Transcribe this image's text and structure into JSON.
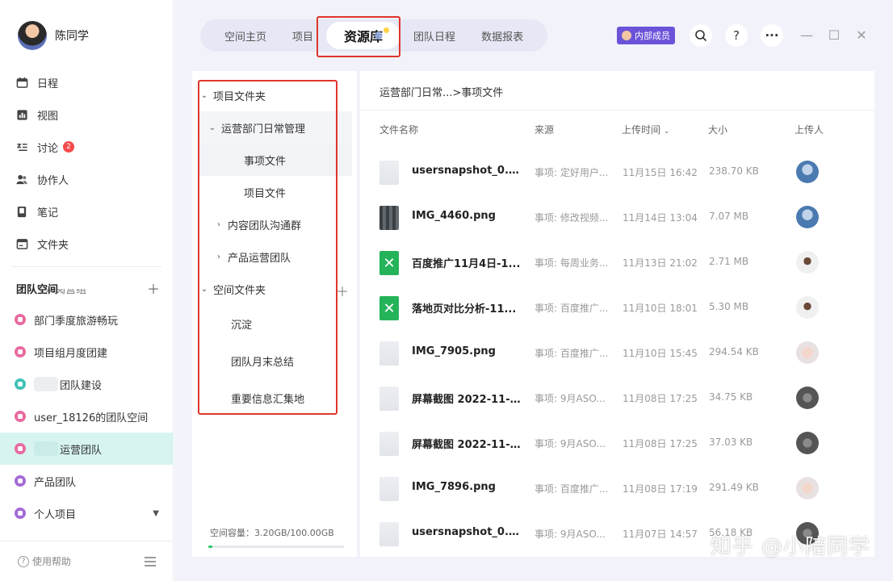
{
  "user": {
    "name": "陈同学"
  },
  "nav": [
    {
      "label": "日程",
      "icon": "calendar-icon"
    },
    {
      "label": "视图",
      "icon": "chart-icon"
    },
    {
      "label": "讨论",
      "icon": "discussion-icon",
      "badge": "2"
    },
    {
      "label": "协作人",
      "icon": "people-icon"
    },
    {
      "label": "笔记",
      "icon": "note-icon"
    },
    {
      "label": "文件夹",
      "icon": "folder-icon"
    }
  ],
  "team_space": {
    "title": "团队空间",
    "cut_label": "飞浆阅营组",
    "items": [
      {
        "label": "部门季度旅游畅玩",
        "color": "#e86aa0"
      },
      {
        "label": "项目组月度团建",
        "color": "#e86aa0"
      },
      {
        "label": "团队建设",
        "color": "#3ec2b5",
        "blurred": true
      },
      {
        "label": "user_18126的团队空间",
        "color": "#e86aa0"
      },
      {
        "label": "运营团队",
        "color": "#e86aa0",
        "blurred": true,
        "active": true
      },
      {
        "label": "产品团队",
        "color": "#a36ad6"
      },
      {
        "label": "个人项目",
        "color": "#a36ad6",
        "caret": "▼"
      }
    ]
  },
  "footer": {
    "help": "使用帮助"
  },
  "tabs": [
    {
      "label": "空间主页"
    },
    {
      "label": "项目"
    },
    {
      "label": "资源库",
      "active": true
    },
    {
      "label": "团队日程"
    },
    {
      "label": "数据报表"
    }
  ],
  "header": {
    "member_tag": "内部成员"
  },
  "tree": {
    "project_folder": "项目文件夹",
    "dept_group": "运营部门日常管理",
    "matter_files": "事项文件",
    "project_files": "项目文件",
    "content_group": "内容团队沟通群",
    "product_group": "产品运营团队",
    "space_folder": "空间文件夹",
    "space_items": [
      "沉淀",
      "团队月末总结",
      "重要信息汇集地"
    ],
    "capacity": "空间容量：3.20GB/100.00GB",
    "capacity_used_fraction": 0.032
  },
  "files": {
    "breadcrumb": "运营部门日常...>事项文件",
    "columns": {
      "name": "文件名称",
      "source": "来源",
      "time": "上传时间",
      "size": "大小",
      "uploader": "上传人"
    },
    "rows": [
      {
        "name": "usersnapshot_0.7...",
        "source": "事项: 定好用户...",
        "time": "11月15日 16:42",
        "size": "238.70 KB",
        "thumb": "doc",
        "uploader": "ua-a"
      },
      {
        "name": "IMG_4460.png",
        "source": "事项: 修改视频...",
        "time": "11月14日 13:04",
        "size": "7.07 MB",
        "thumb": "img",
        "uploader": "ua-a"
      },
      {
        "name": "百度推广11月4日-1...",
        "source": "事项: 每周业务...",
        "time": "11月13日 21:02",
        "size": "2.71 MB",
        "thumb": "xls",
        "uploader": "ua-b"
      },
      {
        "name": "落地页对比分析-11...",
        "source": "事项: 百度推广...",
        "time": "11月10日 18:01",
        "size": "5.30 MB",
        "thumb": "xls",
        "uploader": "ua-b"
      },
      {
        "name": "IMG_7905.png",
        "source": "事项: 百度推广...",
        "time": "11月10日 15:45",
        "size": "294.54 KB",
        "thumb": "doc",
        "uploader": "ua-c"
      },
      {
        "name": "屏幕截图 2022-11-...",
        "source": "事项: 9月ASO...",
        "time": "11月08日 17:25",
        "size": "34.75 KB",
        "thumb": "doc",
        "uploader": "ua-d"
      },
      {
        "name": "屏幕截图 2022-11-...",
        "source": "事项: 9月ASO...",
        "time": "11月08日 17:25",
        "size": "37.03 KB",
        "thumb": "doc",
        "uploader": "ua-d"
      },
      {
        "name": "IMG_7896.png",
        "source": "事项: 百度推广...",
        "time": "11月08日 17:19",
        "size": "291.49 KB",
        "thumb": "doc",
        "uploader": "ua-c"
      },
      {
        "name": "usersnapshot_0.6...",
        "source": "事项: 9月ASO...",
        "time": "11月07日 14:57",
        "size": "56.18 KB",
        "thumb": "doc",
        "uploader": "ua-d"
      }
    ]
  },
  "watermark": "知乎 @小陪同学"
}
